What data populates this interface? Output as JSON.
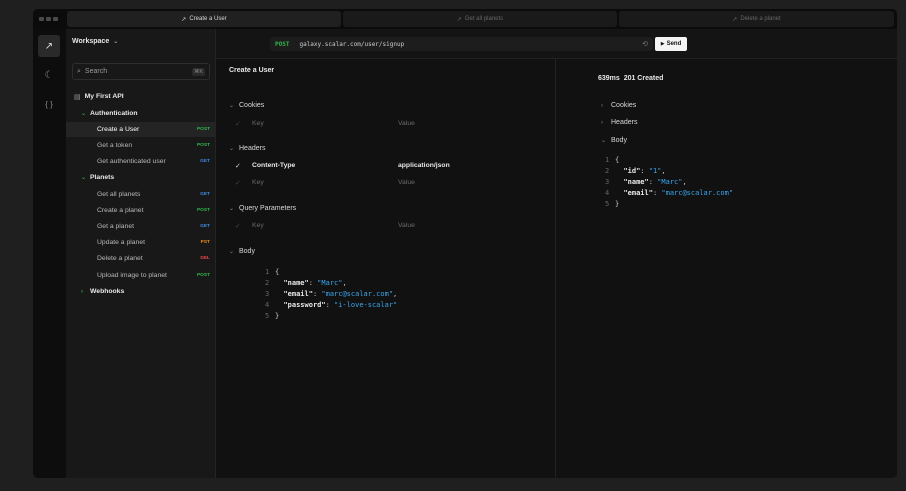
{
  "tabs": [
    {
      "label": "Create a User",
      "icon": "arrow-up-right-icon",
      "active": true
    },
    {
      "label": "Get all planets",
      "icon": "arrow-up-right-icon",
      "active": false
    },
    {
      "label": "Delete a planet",
      "icon": "arrow-up-right-icon",
      "active": false
    }
  ],
  "rail": {
    "items": [
      "arrow-up-right-icon",
      "moon-icon",
      "braces-icon"
    ]
  },
  "sidebar": {
    "workspace": "Workspace",
    "search_placeholder": "Search",
    "search_shortcut": "⌘K",
    "collection": "My First API",
    "items": [
      {
        "label": "Authentication",
        "type": "folder"
      },
      {
        "label": "Create a User",
        "method": "POST",
        "selected": true
      },
      {
        "label": "Get a token",
        "method": "POST"
      },
      {
        "label": "Get authenticated user",
        "method": "GET"
      },
      {
        "label": "Planets",
        "type": "folder"
      },
      {
        "label": "Get all planets",
        "method": "GET"
      },
      {
        "label": "Create a planet",
        "method": "POST"
      },
      {
        "label": "Get a planet",
        "method": "GET"
      },
      {
        "label": "Update a planet",
        "method": "PST"
      },
      {
        "label": "Delete a planet",
        "method": "DEL"
      },
      {
        "label": "Upload image to planet",
        "method": "POST"
      },
      {
        "label": "Webhooks",
        "type": "folder"
      }
    ]
  },
  "request": {
    "method": "POST",
    "url": "galaxy.scalar.com/user/signup",
    "send_label": "Send",
    "title": "Create a User",
    "sections": {
      "cookies": "Cookies",
      "headers": "Headers",
      "query": "Query Parameters",
      "body": "Body"
    },
    "placeholder_key": "Key",
    "placeholder_value": "Value",
    "header_key": "Content-Type",
    "header_value": "application/json",
    "body_lines": [
      {
        "n": "1",
        "text": "{"
      },
      {
        "n": "2",
        "key": "\"name\"",
        "val": "\"Marc\"",
        "tail": ","
      },
      {
        "n": "3",
        "key": "\"email\"",
        "val": "\"marc@scalar.com\"",
        "tail": ","
      },
      {
        "n": "4",
        "key": "\"password\"",
        "val": "\"i-love-scalar\"",
        "tail": ""
      },
      {
        "n": "5",
        "text": "}"
      }
    ]
  },
  "response": {
    "time": "639ms",
    "status": "201 Created",
    "sections": {
      "cookies": "Cookies",
      "headers": "Headers",
      "body": "Body"
    },
    "body_lines": [
      {
        "n": "1",
        "text": "{"
      },
      {
        "n": "2",
        "key": "\"id\"",
        "val": "\"1\"",
        "tail": ","
      },
      {
        "n": "3",
        "key": "\"name\"",
        "val": "\"Marc\"",
        "tail": ","
      },
      {
        "n": "4",
        "key": "\"email\"",
        "val": "\"marc@scalar.com\"",
        "tail": ""
      },
      {
        "n": "5",
        "text": "}"
      }
    ]
  },
  "colors": {
    "post": "#2fb84a",
    "get": "#3b8de8",
    "put": "#f08a24",
    "delete": "#e5484d",
    "string": "#3aa7f0"
  }
}
